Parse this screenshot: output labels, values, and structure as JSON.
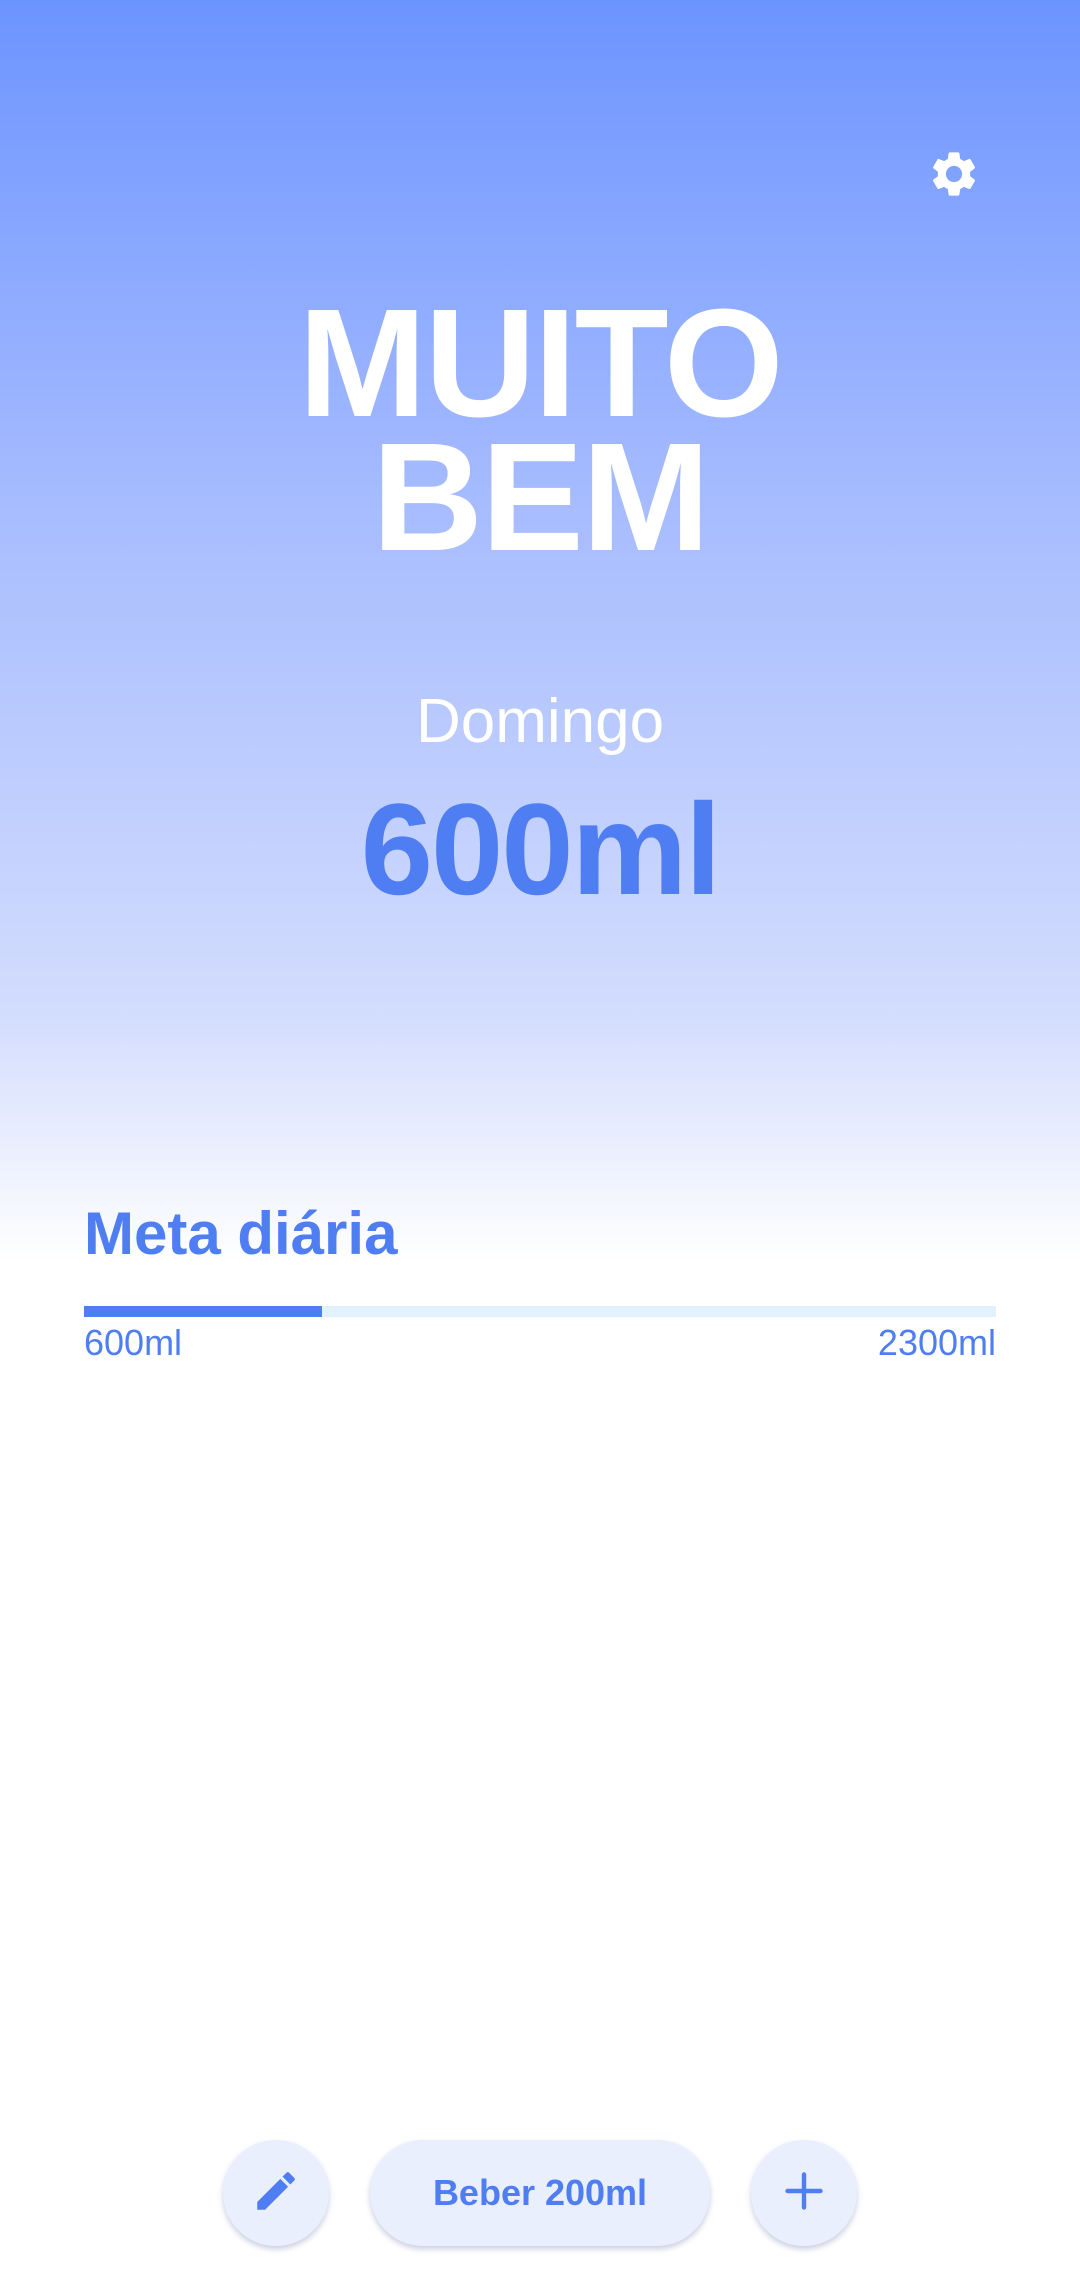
{
  "header": {
    "settings_icon": "gear-icon"
  },
  "hero": {
    "title_line1": "MUITO",
    "title_line2": "BEM"
  },
  "today": {
    "day": "Domingo",
    "amount": "600ml"
  },
  "goal": {
    "title": "Meta diária",
    "current_label": "600ml",
    "goal_label": "2300ml",
    "progress_fraction": 0.261
  },
  "actions": {
    "edit_icon": "pencil-icon",
    "drink_label": "Beber 200ml",
    "add_icon": "plus-icon"
  },
  "colors": {
    "accent": "#4f7df2",
    "gradient_top": "#6c94ff",
    "track": "#e2f2fd",
    "button_bg": "#e9effd"
  }
}
